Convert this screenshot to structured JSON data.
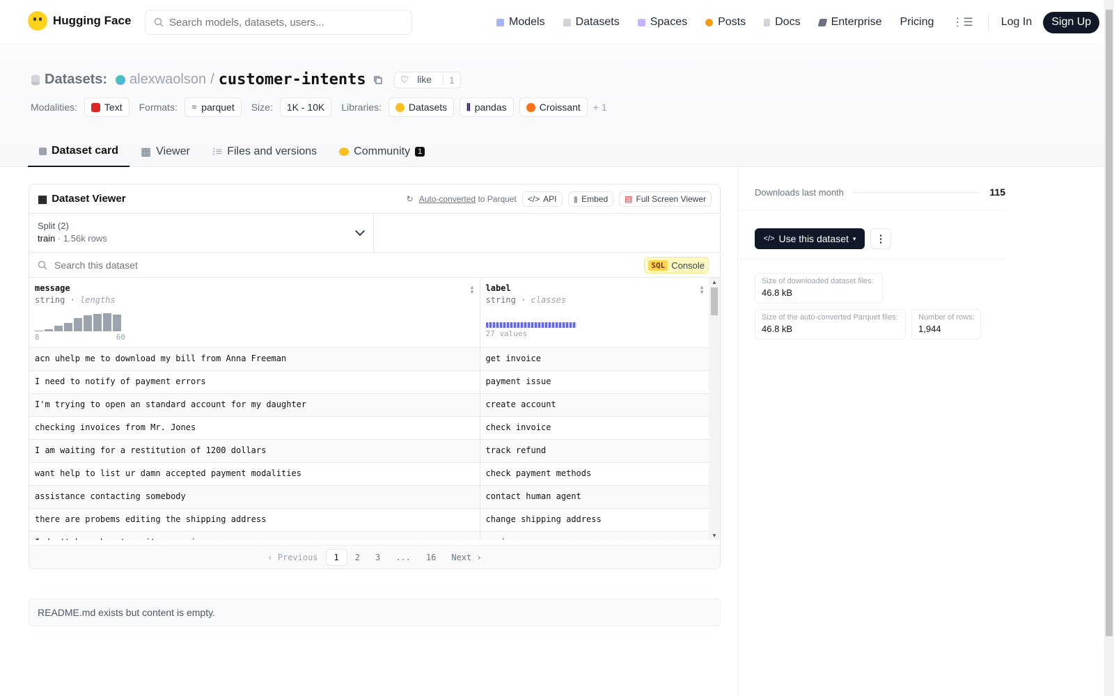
{
  "nav": {
    "brand": "Hugging Face",
    "search_placeholder": "Search models, datasets, users...",
    "links": [
      "Models",
      "Datasets",
      "Spaces",
      "Posts",
      "Docs",
      "Enterprise",
      "Pricing"
    ],
    "login": "Log In",
    "signup": "Sign Up"
  },
  "header": {
    "section_label": "Datasets:",
    "owner": "alexwaolson",
    "separator": "/",
    "repo": "customer-intents",
    "like_label": "like",
    "like_count": "1",
    "tags": {
      "modalities_label": "Modalities:",
      "modalities": [
        "Text"
      ],
      "formats_label": "Formats:",
      "formats": [
        "parquet"
      ],
      "size_label": "Size:",
      "size": [
        "1K - 10K"
      ],
      "libraries_label": "Libraries:",
      "libraries": [
        "Datasets",
        "pandas",
        "Croissant"
      ],
      "more": "+ 1"
    },
    "tabs": [
      "Dataset card",
      "Viewer",
      "Files and versions",
      "Community"
    ],
    "community_badge": "1"
  },
  "viewer": {
    "title": "Dataset Viewer",
    "auto_converted": "Auto-converted",
    "to_parquet": "to Parquet",
    "api": "API",
    "embed": "Embed",
    "full_screen": "Full Screen Viewer",
    "split_label": "Split (2)",
    "split_value": "train",
    "split_dot": "·",
    "split_rows": "1.56k rows",
    "search_placeholder": "Search this dataset",
    "sql_tag": "SQL",
    "sql_label": "Console",
    "columns": [
      {
        "name": "message",
        "type": "string",
        "stat": "lengths",
        "min": "8",
        "max": "60",
        "histogram": [
          1,
          3,
          8,
          12,
          18,
          22,
          24,
          25,
          23
        ]
      },
      {
        "name": "label",
        "type": "string",
        "stat": "classes",
        "values": "27 values"
      }
    ],
    "rows": [
      [
        "acn uhelp me to download my bill from Anna Freeman",
        "get invoice"
      ],
      [
        "I need to notify of payment errors",
        "payment issue"
      ],
      [
        "I'm trying to open an standard account for my daughter",
        "create account"
      ],
      [
        "checking invoices from Mr. Jones",
        "check invoice"
      ],
      [
        "I am waiting for a restitution of 1200 dollars",
        "track refund"
      ],
      [
        "want help to list ur damn accepted payment modalities",
        "check payment methods"
      ],
      [
        "assistance contacting somebody",
        "contact human agent"
      ],
      [
        "there are probems editing the shipping address",
        "change shipping address"
      ],
      [
        "I don't know how to write a review",
        "review"
      ]
    ],
    "pager": {
      "prev": "Previous",
      "pages": [
        "1",
        "2",
        "3",
        "...",
        "16"
      ],
      "next": "Next",
      "current": "1"
    }
  },
  "readme_note": "README.md exists but content is empty.",
  "sidebar": {
    "downloads_label": "Downloads last month",
    "downloads": "115",
    "use_button": "Use this dataset",
    "stats": [
      {
        "label": "Size of downloaded dataset files:",
        "value": "46.8 kB"
      },
      {
        "label": "Size of the auto-converted Parquet files:",
        "value": "46.8 kB"
      },
      {
        "label": "Number of rows:",
        "value": "1,944"
      }
    ]
  }
}
